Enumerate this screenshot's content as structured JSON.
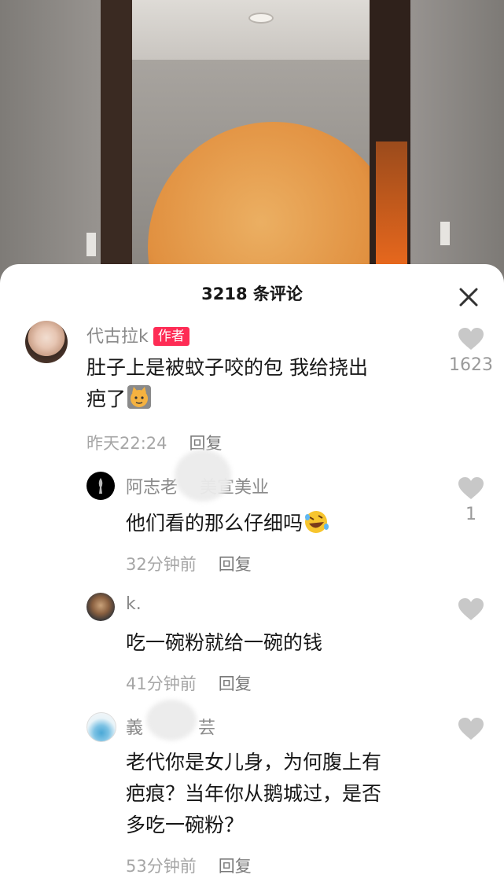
{
  "header": {
    "title": "3218 条评论"
  },
  "comments": [
    {
      "name": "代古拉k",
      "tag": "作者",
      "text_line1": "肚子上是被蚊子咬的包 我给挠出",
      "text_line2": "疤了",
      "time": "昨天22:24",
      "reply": "回复",
      "likes": "1623"
    },
    {
      "name_a": "阿志老",
      "name_b": "美宣美业",
      "text": "他们看的那么仔细吗",
      "time": "32分钟前",
      "reply": "回复",
      "likes": "1"
    },
    {
      "name": "k.",
      "text": "吃一碗粉就给一碗的钱",
      "time": "41分钟前",
      "reply": "回复"
    },
    {
      "name_a": "義",
      "name_b": "芸",
      "text_line1": "老代你是女儿身，为何腹上有",
      "text_line2": "疤痕？当年你从鹅城过，是否",
      "text_line3": "多吃一碗粉？",
      "time": "53分钟前",
      "reply": "回复"
    }
  ],
  "icons": {
    "close": "close-icon",
    "like": "heart-icon",
    "emoji_cat": "cat-emoji-icon",
    "emoji_laugh": "laughing-emoji-icon"
  },
  "colors": {
    "author_tag": "#fe2c55",
    "heart": "#c8c8c8"
  }
}
